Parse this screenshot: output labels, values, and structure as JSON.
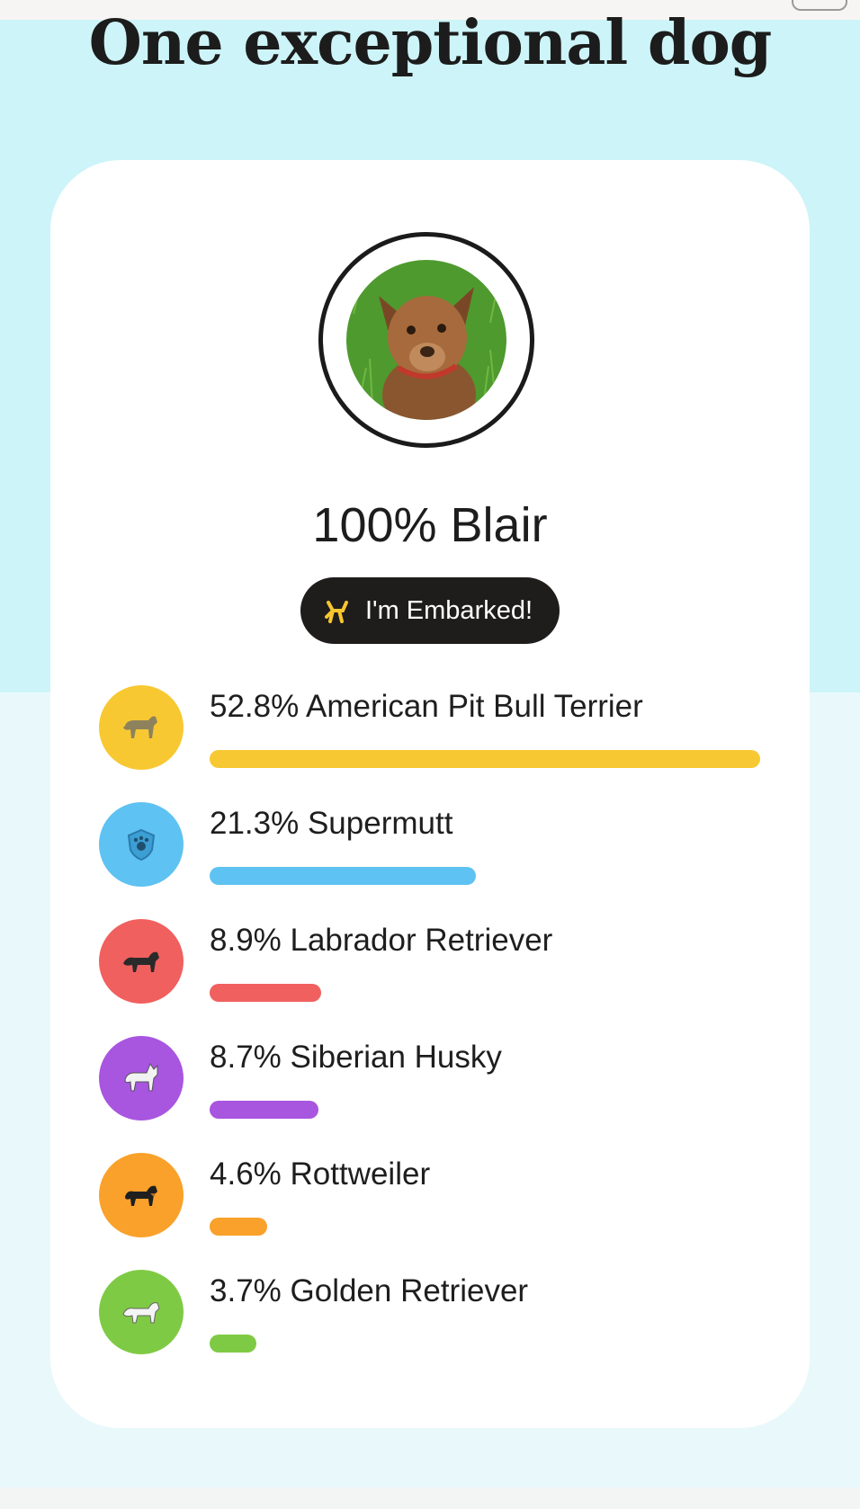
{
  "headline": "One exceptional dog",
  "profile": {
    "name_line": "100% Blair",
    "badge_label": "I'm Embarked!",
    "badge_icon": "balloon-dog-icon",
    "badge_icon_color": "#f6c62f"
  },
  "colors": {
    "background_top": "#cdf4f8",
    "background_bottom": "#e9f9fb",
    "card": "#ffffff",
    "text": "#1d1d1d"
  },
  "breeds": [
    {
      "label": "52.8% American Pit Bull Terrier",
      "percent": 52.8,
      "color": "#f8c832",
      "icon": "pit-bull-icon"
    },
    {
      "label": "21.3% Supermutt",
      "percent": 21.3,
      "color": "#5ec2f2",
      "icon": "supermutt-shield-icon"
    },
    {
      "label": "8.9% Labrador Retriever",
      "percent": 8.9,
      "color": "#f0605e",
      "icon": "labrador-icon"
    },
    {
      "label": "8.7% Siberian Husky",
      "percent": 8.7,
      "color": "#a855e0",
      "icon": "husky-icon"
    },
    {
      "label": "4.6% Rottweiler",
      "percent": 4.6,
      "color": "#f9a12b",
      "icon": "rottweiler-icon"
    },
    {
      "label": "3.7% Golden Retriever",
      "percent": 3.7,
      "color": "#7fca45",
      "icon": "golden-retriever-icon"
    }
  ]
}
